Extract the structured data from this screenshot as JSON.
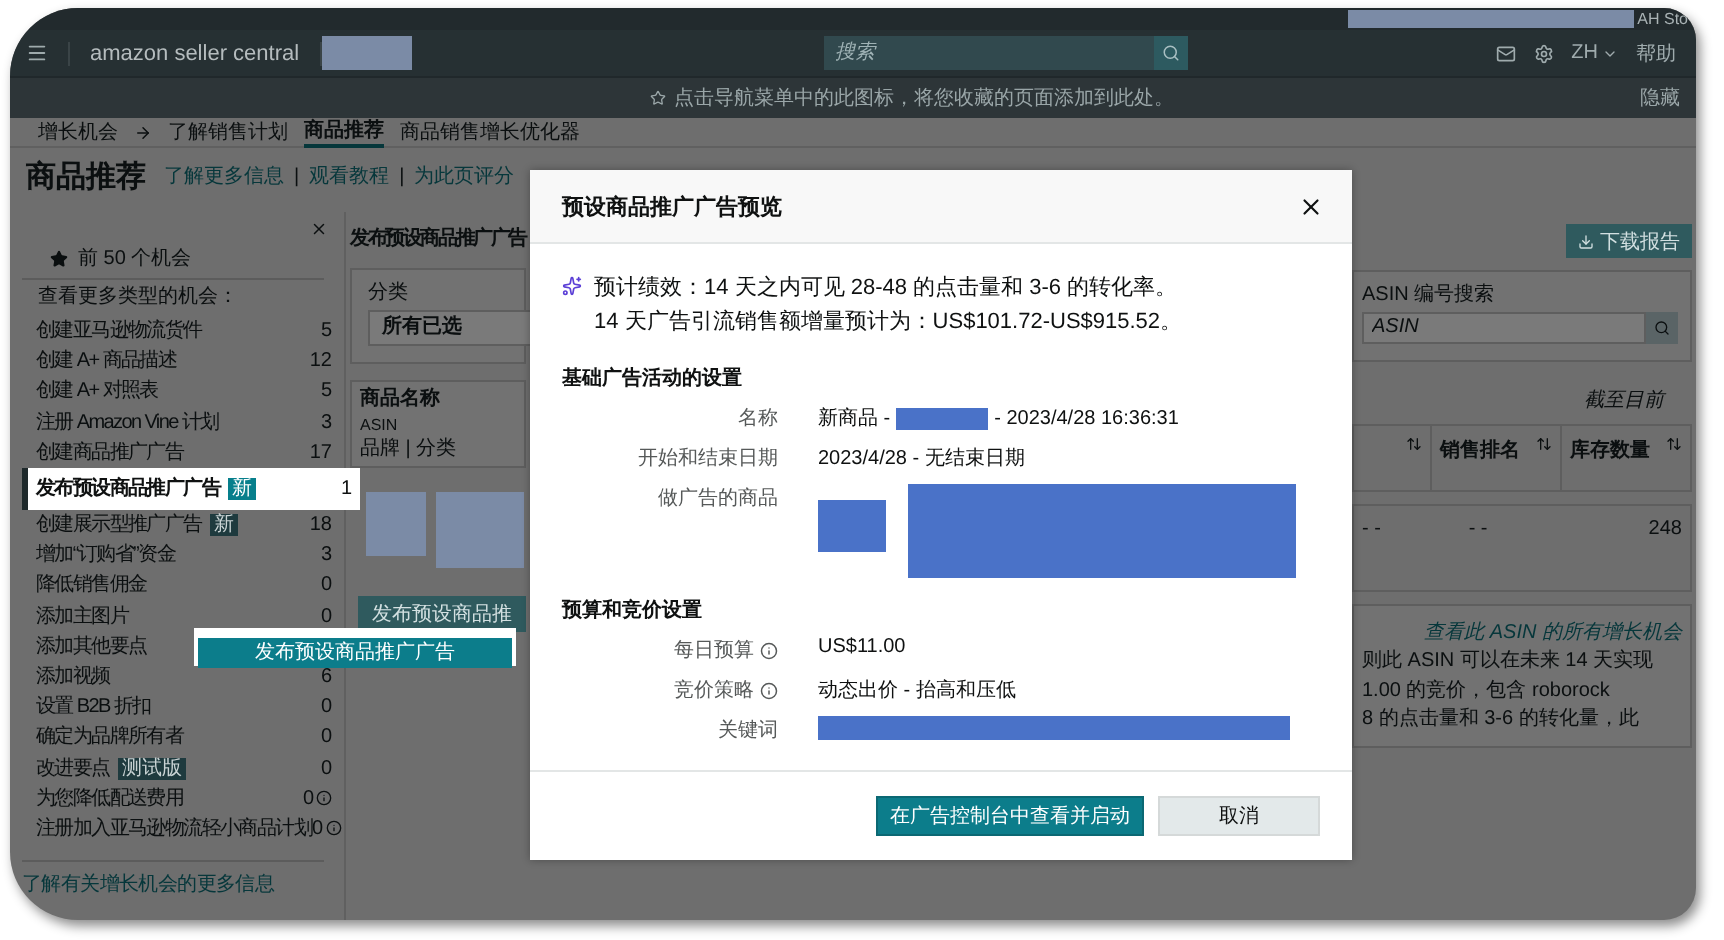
{
  "top_bar": {
    "account": "AH Sto"
  },
  "nav": {
    "logo": "amazon seller central",
    "search": {
      "placeholder": "搜索"
    },
    "language": "ZH",
    "help": "帮助"
  },
  "notice": {
    "text": "点击导航菜单中的此图标，将您收藏的页面添加到此处。",
    "hide": "隐藏"
  },
  "breadcrumb": [
    {
      "label": "增长机会",
      "selected": false
    },
    {
      "label": "了解销售计划",
      "selected": false
    },
    {
      "label": "商品推荐",
      "selected": true
    },
    {
      "label": "商品销售增长优化器",
      "selected": false
    }
  ],
  "page": {
    "title": "商品推荐",
    "links": [
      {
        "kind": "link",
        "text": "了解更多信息"
      },
      {
        "kind": "separator",
        "text": "|"
      },
      {
        "kind": "link",
        "text": "观看教程"
      },
      {
        "kind": "separator",
        "text": "|"
      },
      {
        "kind": "link",
        "text": "为此页评分"
      }
    ]
  },
  "sidebar": {
    "top_item": "前 50 个机会",
    "heading": "查看更多类型的机会：",
    "items": [
      {
        "label": "创建亚马逊物流货件",
        "count": "5",
        "selected": false
      },
      {
        "label": "创建 A+ 商品描述",
        "count": "12",
        "selected": false
      },
      {
        "label": "创建 A+ 对照表",
        "count": "5",
        "selected": false
      },
      {
        "label": "注册 Amazon Vine 计划",
        "count": "3",
        "selected": false
      },
      {
        "label": "创建商品推广广告",
        "count": "17",
        "selected": false
      },
      {
        "label": "发布预设商品推广广告",
        "badge": "新",
        "count": "1",
        "selected": true
      },
      {
        "label": "创建展示型推广广告",
        "badge": "新",
        "count": "18",
        "selected": false
      },
      {
        "label": "增加“订购省”资金",
        "count": "3",
        "selected": false
      },
      {
        "label": "降低销售佣金",
        "count": "0",
        "selected": false
      },
      {
        "label": "添加主图片",
        "count": "0",
        "selected": false
      },
      {
        "label": "添加其他要点",
        "selected": false
      },
      {
        "label": "添加视频",
        "count": "6",
        "selected": false
      },
      {
        "label": "设置 B2B 折扣",
        "count": "0",
        "selected": false
      },
      {
        "label": "确定为品牌所有者",
        "count": "0",
        "selected": false
      },
      {
        "label": "改进要点",
        "badge": "测试版",
        "count": "0",
        "selected": false
      },
      {
        "label": "为您降低配送费用",
        "count": "0",
        "info": true,
        "selected": false
      },
      {
        "label": "注册加入亚马逊物流轻小商品计划",
        "count": "0",
        "info": true,
        "selected": false
      }
    ],
    "footer_link": "了解有关增长机会的更多信息"
  },
  "main": {
    "heading": "发布预设商品推广广告",
    "filter": {
      "label": "分类",
      "value": "所有已选"
    },
    "table_header": {
      "title": "商品名称",
      "asin": "ASIN",
      "brand": "品牌 | 分类"
    },
    "row_button": "发布预设商品推",
    "download": "下载报告",
    "search": {
      "label": "ASIN 编号搜索",
      "placeholder": "ASIN"
    },
    "as_of": "截至目前",
    "columns": [
      "销售排名",
      "库存数量"
    ],
    "row": {
      "column_1": "- -",
      "column_2": "- -",
      "inventory": "248"
    },
    "details": [
      "则此 ASIN 可以在未来 14 天实现",
      "1.00 的竞价，包含 roborock",
      "8 的点击量和 3-6 的转化量，此"
    ],
    "asin_link": "查看此 ASIN 的所有增长机会"
  },
  "callout_button": "发布预设商品推广广告",
  "modal": {
    "title": "预设商品推广广告预览",
    "estimate": [
      "预计绩效：14 天之内可见 28-48 的点击量和 3-6 的转化率。",
      "14 天广告引流销售额增量预计为：US$101.72-US$915.52。"
    ],
    "sections": [
      {
        "title": "基础广告活动的设置",
        "rows": [
          {
            "kind": "name",
            "label": "名称",
            "prefix": "新商品 -",
            "suffix": "- 2023/4/28 16:36:31"
          },
          {
            "kind": "text",
            "label": "开始和结束日期",
            "value": "2023/4/28 - 无结束日期"
          },
          {
            "kind": "products",
            "label": "做广告的商品"
          }
        ]
      },
      {
        "title": "预算和竞价设置",
        "rows": [
          {
            "kind": "text",
            "label": "每日预算",
            "value": "US$11.00",
            "info": true
          },
          {
            "kind": "text",
            "label": "竞价策略",
            "value": "动态出价 - 抬高和压低",
            "info": true
          },
          {
            "kind": "keywords",
            "label": "关键词"
          }
        ]
      }
    ],
    "buttons": [
      {
        "label": "在广告控制台中查看并启动",
        "kind": "primary"
      },
      {
        "label": "取消",
        "kind": "secondary"
      }
    ]
  }
}
